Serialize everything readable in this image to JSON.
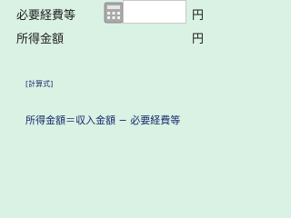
{
  "rows": [
    {
      "label": "必要経費等",
      "unit": "円",
      "value": ""
    },
    {
      "label": "所得金額",
      "unit": "円"
    }
  ],
  "formula": {
    "label": "[計算式]",
    "text": "所得金額＝収入金額 − 必要経費等"
  },
  "icons": {
    "calculator": "calculator-icon"
  },
  "colors": {
    "background": "#d9f2e4",
    "formula_text": "#1a2a6c"
  }
}
